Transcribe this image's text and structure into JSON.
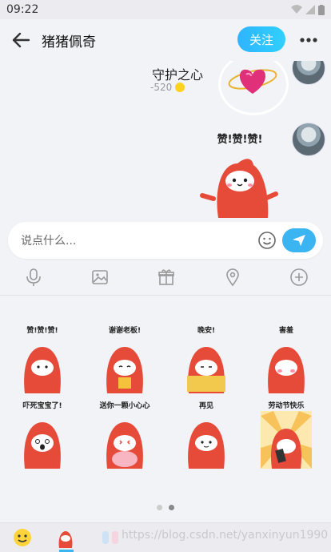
{
  "status": {
    "time": "09:22"
  },
  "header": {
    "title": "猪猪佩奇",
    "follow_label": "关注"
  },
  "gift": {
    "name": "守护之心",
    "value": "-520"
  },
  "bubble_sticker_caption": "赞!赞!赞!",
  "input": {
    "placeholder": "说点什么..."
  },
  "stickers": [
    {
      "caption": "赞!赞!赞!"
    },
    {
      "caption": "谢谢老板!"
    },
    {
      "caption": "晚安!"
    },
    {
      "caption": "害羞"
    },
    {
      "caption": "吓死宝宝了!"
    },
    {
      "caption": "送你一颗小心心"
    },
    {
      "caption": "再见"
    },
    {
      "caption": "劳动节快乐"
    }
  ],
  "pager": {
    "pages": 2,
    "current": 2
  },
  "watermark": "https://blog.csdn.net/yanxinyun1990",
  "colors": {
    "accent": "#3bb4f2",
    "mascot_red": "#e64b3a"
  },
  "icons": [
    "back-arrow-icon",
    "more-icon",
    "smiley-icon",
    "send-icon",
    "microphone-icon",
    "image-icon",
    "gift-icon",
    "location-icon",
    "plus-icon"
  ]
}
